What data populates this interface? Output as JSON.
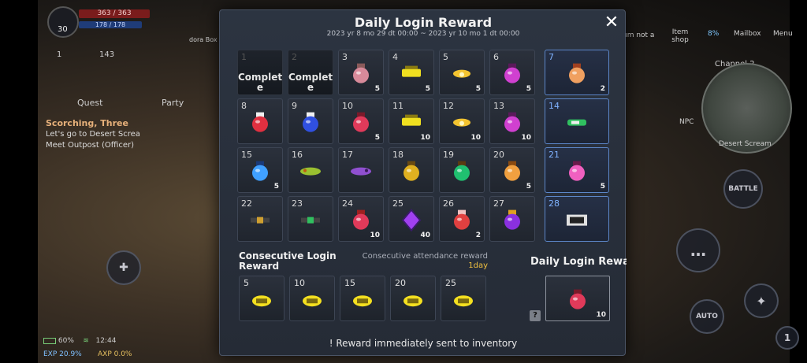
{
  "hud": {
    "level": "30",
    "hp": "363 / 363",
    "mp": "178 / 178",
    "stat_a": "1",
    "stat_b": "143",
    "quest_tab": "Quest",
    "party_tab": "Party",
    "quest_title": "Scorching, Three",
    "quest_line1": "Let's go to Desert Screa",
    "quest_line2": "Meet Outpost (Officer)",
    "top_items": [
      "Item shop",
      "8%",
      "Mailbox",
      "Menu"
    ],
    "top_partial": "um  not a",
    "dora_box": "dora Box",
    "channel": "Channel 2",
    "npc": "NPC",
    "region": "Desert Scream",
    "battle_btn": "BATTLE",
    "auto_btn": "AUTO",
    "battery": "60%",
    "clock": "12:44",
    "exp": "EXP 20.9%",
    "axp": "AXP 0.0%",
    "badge_count": "1"
  },
  "dialog": {
    "title": "Daily Login Reward",
    "period": "2023 yr 8 mo 29 dt 00:00 ~ 2023 yr 10 mo 1 dt 00:00",
    "close_symbol": "✕",
    "days": [
      {
        "day": "1",
        "complete": "Complet e",
        "icon": "none",
        "qty": ""
      },
      {
        "day": "2",
        "complete": "Complet e",
        "icon": "none",
        "qty": ""
      },
      {
        "day": "3",
        "icon": "pink-bundle",
        "qty": "5"
      },
      {
        "day": "4",
        "icon": "yellow-bowl",
        "qty": "5"
      },
      {
        "day": "5",
        "icon": "yellow-lamp",
        "qty": "5"
      },
      {
        "day": "6",
        "icon": "purple-potion",
        "qty": "5"
      },
      {
        "day": "7",
        "icon": "orange-scroll",
        "qty": "2"
      },
      {
        "day": "8",
        "icon": "red-gauntlet",
        "qty": ""
      },
      {
        "day": "9",
        "icon": "blue-gauntlet",
        "qty": ""
      },
      {
        "day": "10",
        "icon": "red-potion",
        "qty": "5"
      },
      {
        "day": "11",
        "icon": "yellow-bowl",
        "qty": "10"
      },
      {
        "day": "12",
        "icon": "yellow-lamp",
        "qty": "10"
      },
      {
        "day": "13",
        "icon": "purple-potion",
        "qty": "10"
      },
      {
        "day": "14",
        "icon": "green-crossbow",
        "qty": ""
      },
      {
        "day": "15",
        "icon": "blue-potion",
        "qty": "5"
      },
      {
        "day": "16",
        "icon": "green-fish",
        "qty": ""
      },
      {
        "day": "17",
        "icon": "purple-fish",
        "qty": ""
      },
      {
        "day": "18",
        "icon": "gold-orb",
        "qty": ""
      },
      {
        "day": "19",
        "icon": "emerald-ring",
        "qty": ""
      },
      {
        "day": "20",
        "icon": "orange-flask",
        "qty": "5"
      },
      {
        "day": "21",
        "icon": "pink-flask",
        "qty": "5"
      },
      {
        "day": "22",
        "icon": "gold-cannon",
        "qty": ""
      },
      {
        "day": "23",
        "icon": "green-cannon",
        "qty": ""
      },
      {
        "day": "24",
        "icon": "red-potion-pile",
        "qty": "10"
      },
      {
        "day": "25",
        "icon": "purple-crystal",
        "qty": "40"
      },
      {
        "day": "26",
        "icon": "red-scroll",
        "qty": "2"
      },
      {
        "day": "27",
        "icon": "purple-helmet",
        "qty": ""
      },
      {
        "day": "28",
        "icon": "silver-card",
        "qty": ""
      }
    ],
    "consecutive_title": "Consecutive Login Reward",
    "consecutive_att_label": "Consecutive attendance reward",
    "consecutive_att_value": "1day",
    "consecutive": [
      {
        "day": "5",
        "icon": "gold-ticket"
      },
      {
        "day": "10",
        "icon": "gold-ticket"
      },
      {
        "day": "15",
        "icon": "gold-ticket"
      },
      {
        "day": "20",
        "icon": "gold-ticket"
      },
      {
        "day": "25",
        "icon": "gold-ticket"
      }
    ],
    "today_title": "Daily Login Reward",
    "today_item": {
      "icon": "red-potion",
      "qty": "10"
    },
    "help_symbol": "?",
    "footer": "! Reward immediately sent to inventory"
  }
}
